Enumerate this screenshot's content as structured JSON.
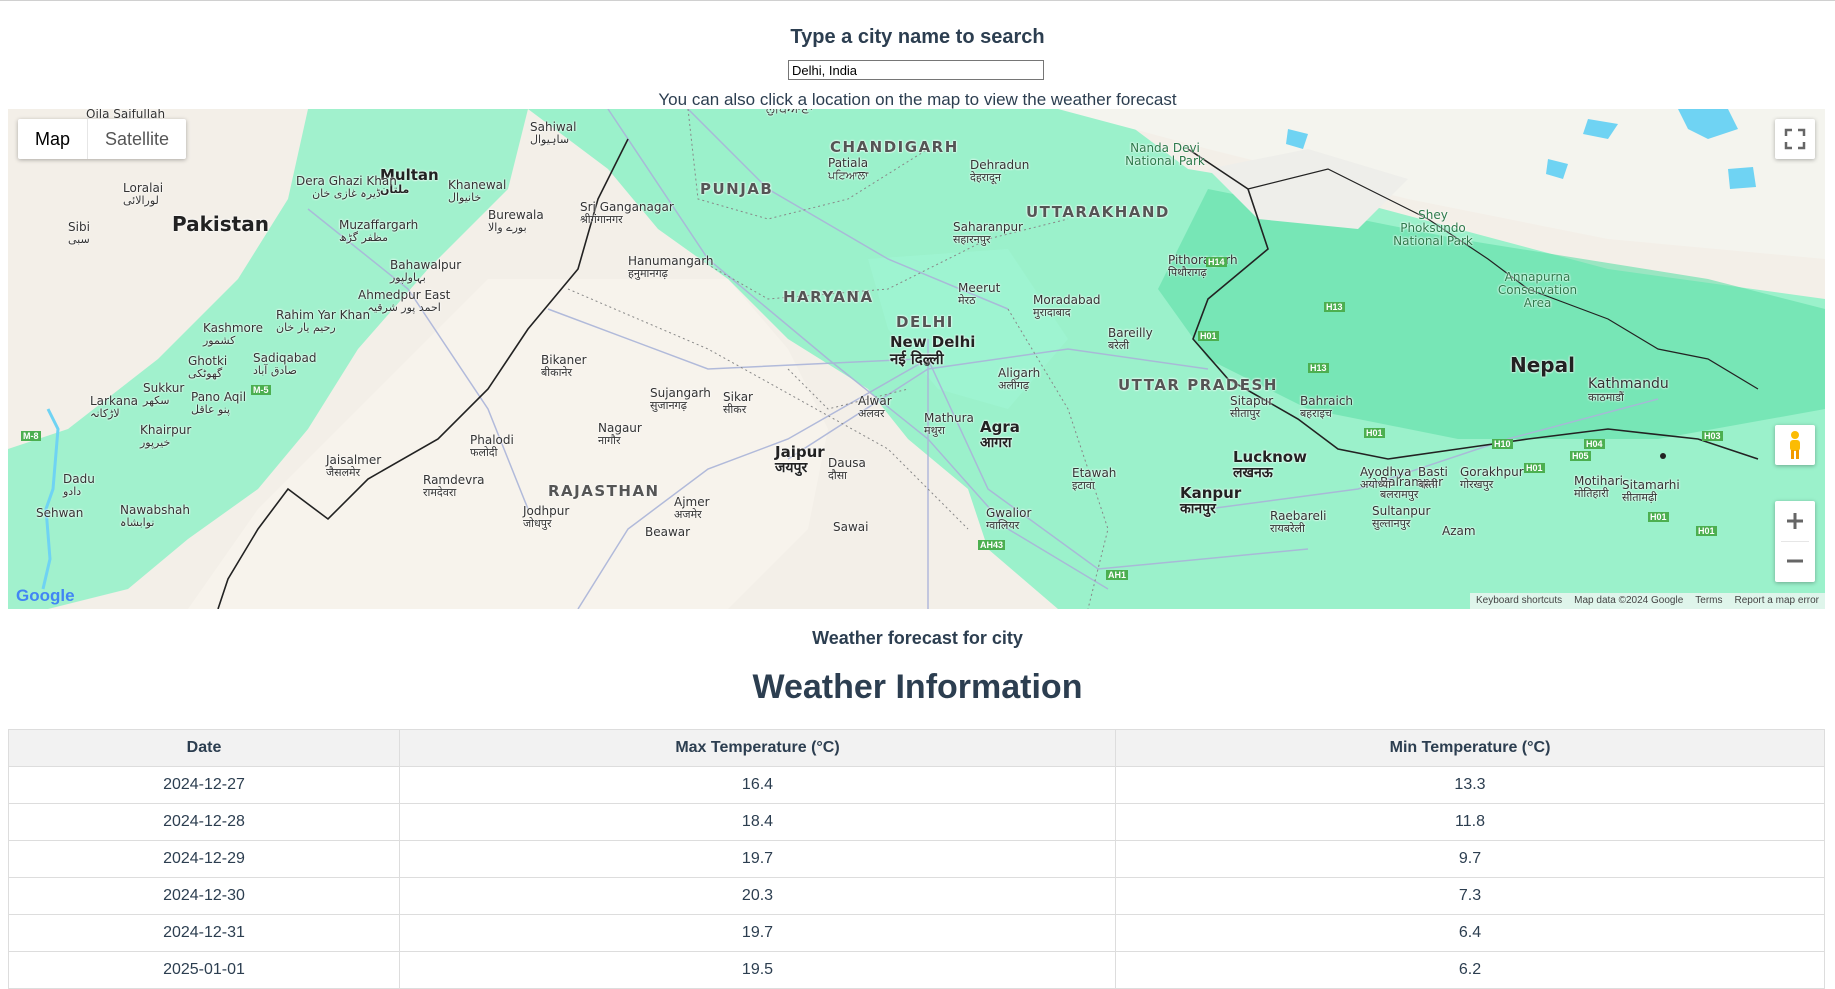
{
  "search": {
    "title": "Type a city name to search",
    "value": "Delhi, India",
    "hint": "You can also click a location on the map to view the weather forecast"
  },
  "map": {
    "type_controls": [
      "Map",
      "Satellite"
    ],
    "active_type": "Map",
    "labels": {
      "pakistan": "Pakistan",
      "nepal": "Nepal",
      "punjab": "PUNJAB",
      "haryana": "HARYANA",
      "chandigarh": "CHANDIGARH",
      "uttarakhand": "UTTARAKHAND",
      "delhi": "DELHI",
      "new_delhi": "New Delhi",
      "new_delhi_hi": "नई दिल्ली",
      "uttar_pradesh": "UTTAR PRADESH",
      "rajasthan": "RAJASTHAN",
      "ludhiana_pa": "ਲੁਧਿਆਣਾ",
      "oila_saifullah": "Oila Saifullah",
      "sahiwal": "Sahiwal",
      "sahiwal_ur": "ساہیوال",
      "multan": "Multan",
      "multan_ur": "ملتان",
      "dera_ghazi_khan": "Dera Ghazi Khan",
      "dera_ghazi_khan_ur": "ڈیرہ غازی خان",
      "khanewal": "Khanewal",
      "khanewal_ur": "خانیوال",
      "burewala": "Burewala",
      "burewala_ur": "بورے والا",
      "loralai": "Loralai",
      "loralai_ur": "لورالائی",
      "muzaffargarh": "Muzaffargarh",
      "muzaffargarh_ur": "مظفر گڑھ",
      "bahawalpur": "Bahawalpur",
      "bahawalpur_ur": "بہاولپور",
      "sri_ganganagar": "Sri Ganganagar",
      "sri_ganganagar_hi": "श्रीगंगानगर",
      "patiala": "Patiala",
      "patiala_pa": "ਪਟਿਆਲਾ",
      "dehradun": "Dehradun",
      "dehradun_hi": "देहरादून",
      "nanda_devi": "Nanda Devi National Park",
      "saharanpur": "Saharanpur",
      "saharanpur_hi": "सहारनपुर",
      "hanumangarh": "Hanumangarh",
      "hanumangarh_hi": "हनुमानगढ़",
      "meerut": "Meerut",
      "meerut_hi": "मेरठ",
      "moradabad": "Moradabad",
      "moradabad_hi": "मुरादाबाद",
      "pithoragarh": "Pithoragarh",
      "pithoragarh_hi": "पिथौरागढ़",
      "shey_phoksundo": "Shey Phoksundo National Park",
      "annapurna": "Annapurna Conservation Area",
      "sibi": "Sibi",
      "sibi_ur": "سبی",
      "ahmedpur_east": "Ahmedpur East",
      "ahmedpur_east_ur": "احمد پور شرقیہ",
      "rahim_yar_khan": "Rahim Yar Khan",
      "rahim_yar_khan_ur": "رحیم یار خان",
      "kashmore": "Kashmore",
      "kashmore_ur": "کشمور",
      "sadiqabad": "Sadiqabad",
      "sadiqabad_ur": "صادق آباد",
      "ghotki": "Ghotki",
      "ghotki_ur": "گھوٹکی",
      "sukkur": "Sukkur",
      "sukkur_ur": "سکھر",
      "larkana": "Larkana",
      "larkana_ur": "لاڑکانہ",
      "pano_aqil": "Pano Aqil",
      "pano_aqil_ur": "پنو عاقل",
      "khairpur": "Khairpur",
      "khairpur_ur": "خیرپور",
      "dadu": "Dadu",
      "dadu_ur": "دادو",
      "sehwan": "Sehwan",
      "nawabshah": "Nawabshah",
      "nawabshah_ur": "نوابشاہ",
      "bikaner": "Bikaner",
      "bikaner_hi": "बीकानेर",
      "sujangarh": "Sujangarh",
      "sujangarh_hi": "सुजानगढ़",
      "sikar": "Sikar",
      "sikar_hi": "सीकर",
      "alwar": "Alwar",
      "alwar_hi": "अलवर",
      "aligarh": "Aligarh",
      "aligarh_hi": "अलीगढ़",
      "bareilly": "Bareilly",
      "bareilly_hi": "बरेली",
      "sitapur": "Sitapur",
      "sitapur_hi": "सीतापुर",
      "bahraich": "Bahraich",
      "bahraich_hi": "बहराइच",
      "kathmandu": "Kathmandu",
      "kathmandu_ne": "काठमाडौं",
      "phalodi": "Phalodi",
      "phalodi_hi": "फलोदी",
      "nagaur": "Nagaur",
      "nagaur_hi": "नागौर",
      "jaipur": "Jaipur",
      "jaipur_hi": "जयपुर",
      "dausa": "Dausa",
      "dausa_hi": "दौसा",
      "mathura": "Mathura",
      "mathura_hi": "मथुरा",
      "agra": "Agra",
      "agra_hi": "आगरा",
      "etawah": "Etawah",
      "etawah_hi": "इटावा",
      "lucknow": "Lucknow",
      "lucknow_hi": "लखनऊ",
      "kanpur": "Kanpur",
      "kanpur_hi": "कानपुर",
      "balrampur": "Balrampur",
      "balrampur_hi": "बलरामपुर",
      "ayodhya": "Ayodhya",
      "ayodhya_hi": "अयोध्या",
      "basti": "Basti",
      "basti_hi": "बस्ती",
      "gorakhpur": "Gorakhpur",
      "gorakhpur_hi": "गोरखपुर",
      "motihari": "Motihari",
      "motihari_hi": "मोतिहारी",
      "sitamarhi": "Sitamarhi",
      "sitamarhi_hi": "सीतामढ़ी",
      "jaisalmer": "Jaisalmer",
      "jaisalmer_hi": "जैसलमेर",
      "ramdevra": "Ramdevra",
      "ramdevra_hi": "रामदेवरा",
      "jodhpur": "Jodhpur",
      "jodhpur_hi": "जोधपुर",
      "ajmer": "Ajmer",
      "ajmer_hi": "अजमेर",
      "beawar": "Beawar",
      "sawai": "Sawai",
      "gwalior": "Gwalior",
      "gwalior_hi": "ग्वालियर",
      "raebareli": "Raebareli",
      "raebareli_hi": "रायबरेली",
      "sultanpur": "Sultanpur",
      "sultanpur_hi": "सुल्तानपुर",
      "azam": "Azam"
    },
    "highways": [
      "M-8",
      "M-5",
      "H14",
      "H01",
      "H13",
      "H13",
      "H01",
      "H10",
      "H04",
      "H05",
      "H03",
      "H01",
      "H01",
      "H01",
      "AH43",
      "AH1"
    ],
    "attribution": {
      "shortcuts": "Keyboard shortcuts",
      "data": "Map data ©2024 Google",
      "terms": "Terms",
      "report": "Report a map error"
    },
    "logo": "Google",
    "colors": {
      "land": "#f3efe8",
      "vegetation": "#7ef2c2",
      "water": "#6fd3f3",
      "roads": "#aab4d9"
    }
  },
  "forecast_title": "Weather forecast for city",
  "weather_title": "Weather Information",
  "table": {
    "headers": [
      "Date",
      "Max Temperature (°C)",
      "Min Temperature (°C)"
    ],
    "rows": [
      [
        "2024-12-27",
        "16.4",
        "13.3"
      ],
      [
        "2024-12-28",
        "18.4",
        "11.8"
      ],
      [
        "2024-12-29",
        "19.7",
        "9.7"
      ],
      [
        "2024-12-30",
        "20.3",
        "7.3"
      ],
      [
        "2024-12-31",
        "19.7",
        "6.4"
      ],
      [
        "2025-01-01",
        "19.5",
        "6.2"
      ]
    ]
  }
}
